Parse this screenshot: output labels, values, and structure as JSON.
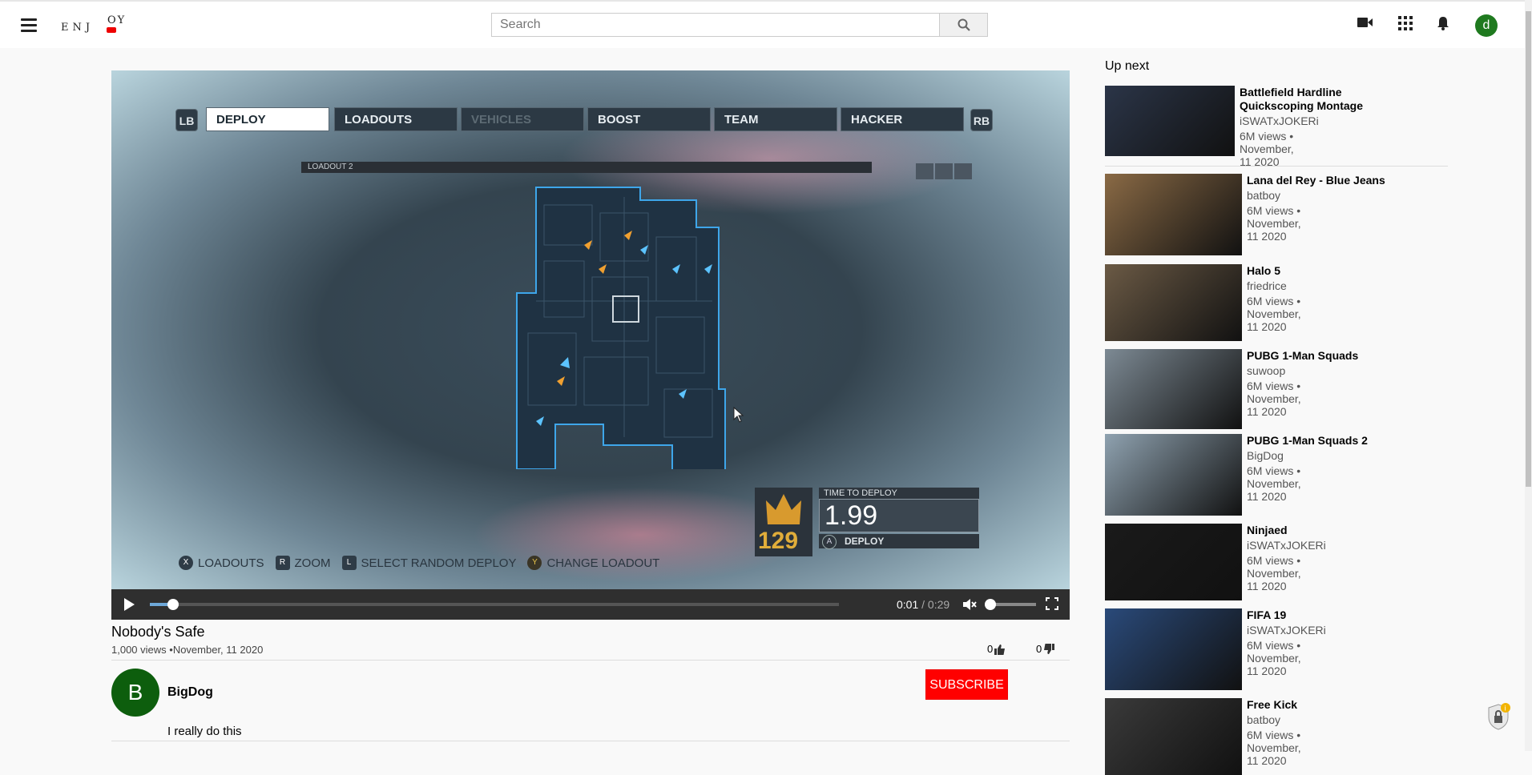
{
  "header": {
    "logo_text_main": "ENJ",
    "logo_text_tail": "OY",
    "search_placeholder": "Search",
    "user_initial": "d"
  },
  "video": {
    "game_hud": {
      "lb": "LB",
      "rb": "RB",
      "tabs": [
        "DEPLOY",
        "LOADOUTS",
        "VEHICLES",
        "BOOST",
        "TEAM",
        "HACKER"
      ],
      "loadout_label": "LOADOUT 2",
      "time_to_deploy_label": "TIME TO DEPLOY",
      "time_to_deploy_value": "1.99",
      "deploy_button": "DEPLOY",
      "deploy_key": "A",
      "crown_number": "129",
      "hints": [
        {
          "key": "X",
          "label": "LOADOUTS"
        },
        {
          "key": "R",
          "label": "ZOOM"
        },
        {
          "key": "L",
          "label": "SELECT RANDOM DEPLOY"
        },
        {
          "key": "Y",
          "label": "CHANGE LOADOUT"
        }
      ]
    },
    "controls": {
      "current_time": "0:01",
      "separator": " / ",
      "duration": "0:29",
      "progress": 0.034,
      "volume": 0.0
    },
    "title": "Nobody's Safe",
    "meta": "1,000 views •November, 11 2020",
    "likes": "0",
    "dislikes": "0"
  },
  "channel": {
    "avatar_letter": "B",
    "name": "BigDog",
    "subscribe_label": "SUBSCRIBE",
    "description": "I really do this"
  },
  "sidebar": {
    "heading": "Up next",
    "items": [
      {
        "title": "Battlefield Hardline Quickscoping Montage",
        "channel": "iSWATxJOKERi",
        "meta": "6M views • November, 11 2020",
        "thumb_color": "#2b3548"
      },
      {
        "title": "Lana del Rey - Blue Jeans",
        "channel": "batboy",
        "meta": "6M views • November, 11 2020",
        "thumb_color": "#8a6a45"
      },
      {
        "title": "Halo 5",
        "channel": "friedrice",
        "meta": "6M views • November, 11 2020",
        "thumb_color": "#6b5a45"
      },
      {
        "title": "PUBG 1-Man Squads",
        "channel": "suwoop",
        "meta": "6M views • November, 11 2020",
        "thumb_color": "#7d8a94"
      },
      {
        "title": "PUBG 1-Man Squads 2",
        "channel": "BigDog",
        "meta": "6M views • November, 11 2020",
        "thumb_color": "#8fa2b0"
      },
      {
        "title": "Ninjaed",
        "channel": "iSWATxJOKERi",
        "meta": "6M views • November, 11 2020",
        "thumb_color": "#1a1a1a"
      },
      {
        "title": "FIFA 19",
        "channel": "iSWATxJOKERi",
        "meta": "6M views • November, 11 2020",
        "thumb_color": "#2a4a7a"
      },
      {
        "title": "Free Kick",
        "channel": "batboy",
        "meta": "6M views • November, 11 2020",
        "thumb_color": "#3a3a3a"
      }
    ]
  }
}
